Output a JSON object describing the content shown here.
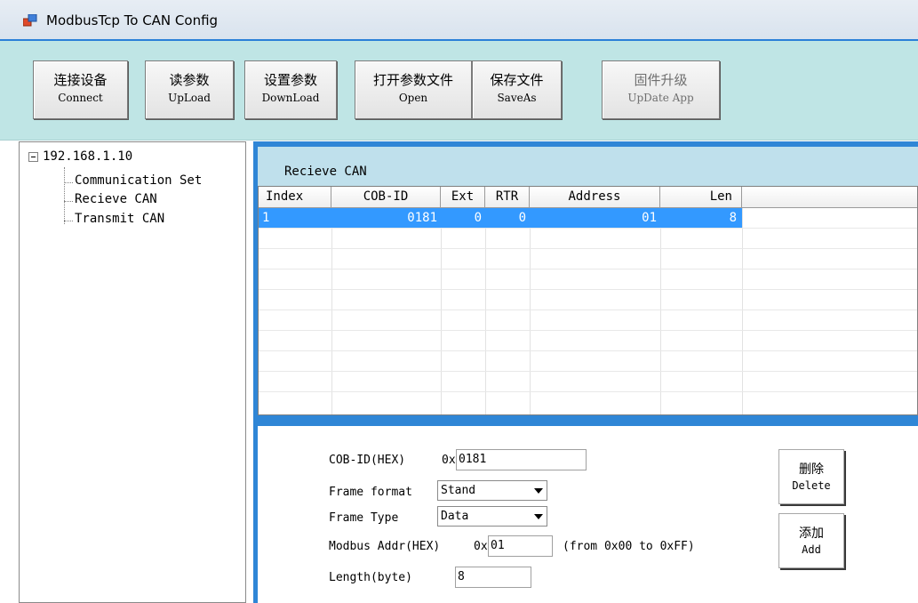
{
  "window": {
    "title": "ModbusTcp To CAN Config"
  },
  "colors": {
    "toolbar_bg": "#bfe5e5",
    "panel_blue": "#2f86d6",
    "selection": "#3399ff"
  },
  "toolbar": {
    "buttons": [
      {
        "cn": "连接设备",
        "en": "Connect",
        "enabled": true
      },
      {
        "cn": "读参数",
        "en": "UpLoad",
        "enabled": true
      },
      {
        "cn": "设置参数",
        "en": "DownLoad",
        "enabled": true
      },
      {
        "cn": "打开参数文件",
        "en": "Open",
        "enabled": true
      },
      {
        "cn": "保存文件",
        "en": "SaveAs",
        "enabled": true
      },
      {
        "cn": "固件升级",
        "en": "UpDate App",
        "enabled": false
      }
    ]
  },
  "tree": {
    "root": "192.168.1.10",
    "children": [
      "Communication Set",
      "Recieve CAN",
      "Transmit CAN"
    ]
  },
  "recieve": {
    "title": "Recieve CAN",
    "columns": [
      "Index",
      "COB-ID",
      "Ext",
      "RTR",
      "Address",
      "Len"
    ],
    "rows": [
      {
        "index": "1",
        "cob_id": "0181",
        "ext": "0",
        "rtr": "0",
        "address": "01",
        "len": "8"
      }
    ]
  },
  "editor": {
    "cob_id_label": "COB-ID(HEX)",
    "cob_prefix": "0x",
    "cob_value": "0181",
    "frame_format_label": "Frame format",
    "frame_format_value": "Stand",
    "frame_type_label": "Frame Type",
    "frame_type_value": "Data",
    "modbus_label": "Modbus Addr(HEX)",
    "modbus_prefix": "0x",
    "modbus_value": "01",
    "modbus_hint": "(from 0x00 to 0xFF)",
    "length_label": "Length(byte)",
    "length_value": "8",
    "delete_cn": "删除",
    "delete_en": "Delete",
    "add_cn": "添加",
    "add_en": "Add"
  }
}
